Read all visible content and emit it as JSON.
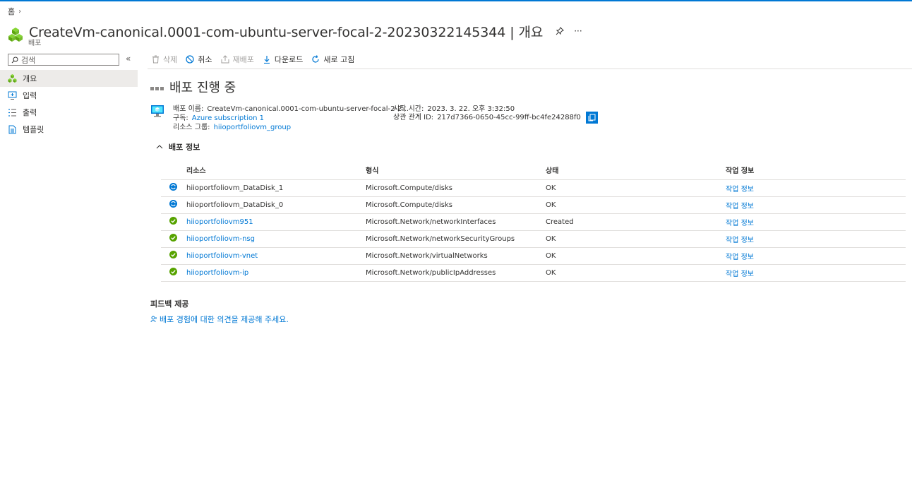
{
  "breadcrumb": {
    "home": "홈"
  },
  "header": {
    "title": "CreateVm-canonical.0001-com-ubuntu-server-focal-2-20230322145344 | 개요",
    "subtitle": "배포",
    "more": "···"
  },
  "sidebar": {
    "search_placeholder": "검색",
    "collapse": "«",
    "items": [
      {
        "label": "개요",
        "icon": "overview-icon",
        "active": true
      },
      {
        "label": "입력",
        "icon": "inputs-icon",
        "active": false
      },
      {
        "label": "출력",
        "icon": "outputs-icon",
        "active": false
      },
      {
        "label": "템플릿",
        "icon": "template-icon",
        "active": false
      }
    ]
  },
  "toolbar": {
    "delete": "삭제",
    "cancel": "취소",
    "redeploy": "재배포",
    "download": "다운로드",
    "refresh": "새로 고침"
  },
  "status": {
    "title": "배포 진행 중"
  },
  "info": {
    "name_label": "배포 이름:",
    "name_value": "CreateVm-canonical.0001-com-ubuntu-server-focal-2-2...",
    "subscription_label": "구독:",
    "subscription_value": "Azure subscription 1",
    "rg_label": "리소스 그룹:",
    "rg_value": "hiioportfoliovm_group",
    "start_label": "시작 시간:",
    "start_value": "2023. 3. 22. 오후 3:32:50",
    "correlation_label": "상관 관계 ID:",
    "correlation_value": "217d7366-0650-45cc-99ff-bc4fe24288f0"
  },
  "details": {
    "section_title": "배포 정보",
    "columns": [
      "리소스",
      "형식",
      "상태",
      "작업 정보"
    ],
    "rows": [
      {
        "status_icon": "in-progress",
        "resource": "hiioportfoliovm_DataDisk_1",
        "resource_link": false,
        "type": "Microsoft.Compute/disks",
        "state": "OK",
        "op": "작업 정보"
      },
      {
        "status_icon": "in-progress",
        "resource": "hiioportfoliovm_DataDisk_0",
        "resource_link": false,
        "type": "Microsoft.Compute/disks",
        "state": "OK",
        "op": "작업 정보"
      },
      {
        "status_icon": "success",
        "resource": "hiioportfoliovm951",
        "resource_link": true,
        "type": "Microsoft.Network/networkInterfaces",
        "state": "Created",
        "op": "작업 정보"
      },
      {
        "status_icon": "success",
        "resource": "hiioportfoliovm-nsg",
        "resource_link": true,
        "type": "Microsoft.Network/networkSecurityGroups",
        "state": "OK",
        "op": "작업 정보"
      },
      {
        "status_icon": "success",
        "resource": "hiioportfoliovm-vnet",
        "resource_link": true,
        "type": "Microsoft.Network/virtualNetworks",
        "state": "OK",
        "op": "작업 정보"
      },
      {
        "status_icon": "success",
        "resource": "hiioportfoliovm-ip",
        "resource_link": true,
        "type": "Microsoft.Network/publicIpAddresses",
        "state": "OK",
        "op": "작업 정보"
      }
    ]
  },
  "feedback": {
    "title": "피드백 제공",
    "link": "배포 경험에 대한 의견을 제공해 주세요."
  },
  "colors": {
    "accent": "#0078d4",
    "success": "#57a300",
    "progress": "#0078d4"
  }
}
